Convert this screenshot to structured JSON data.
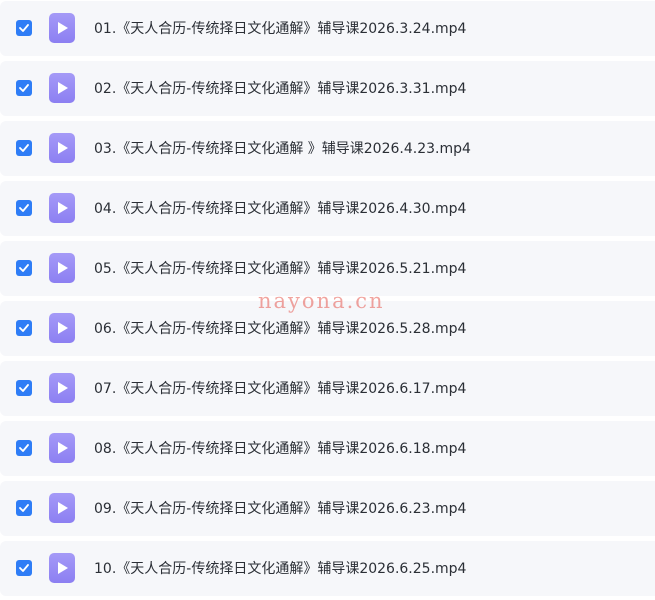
{
  "files": [
    {
      "name": "01.《天人合历-传统择日文化通解》辅导课2026.3.24.mp4",
      "checked": true
    },
    {
      "name": "02.《天人合历-传统择日文化通解》辅导课2026.3.31.mp4",
      "checked": true
    },
    {
      "name": "03.《天人合历-传统择日文化通解 》辅导课2026.4.23.mp4",
      "checked": true
    },
    {
      "name": "04.《天人合历-传统择日文化通解》辅导课2026.4.30.mp4",
      "checked": true
    },
    {
      "name": "05.《天人合历-传统择日文化通解》辅导课2026.5.21.mp4",
      "checked": true
    },
    {
      "name": "06.《天人合历-传统择日文化通解》辅导课2026.5.28.mp4",
      "checked": true
    },
    {
      "name": "07.《天人合历-传统择日文化通解》辅导课2026.6.17.mp4",
      "checked": true
    },
    {
      "name": "08.《天人合历-传统择日文化通解》辅导课2026.6.18.mp4",
      "checked": true
    },
    {
      "name": "09.《天人合历-传统择日文化通解》辅导课2026.6.23.mp4",
      "checked": true
    },
    {
      "name": "10.《天人合历-传统择日文化通解》辅导课2026.6.25.mp4",
      "checked": true
    }
  ],
  "icons": {
    "checkbox": "checkbox-checked-icon",
    "file": "video-file-play-icon"
  },
  "colors": {
    "checkbox": "#2f7df6",
    "file_icon": "#9a8ef5",
    "row_background": "#f6f7fa",
    "text": "#2b2f36"
  },
  "watermark": "nayona.cn"
}
